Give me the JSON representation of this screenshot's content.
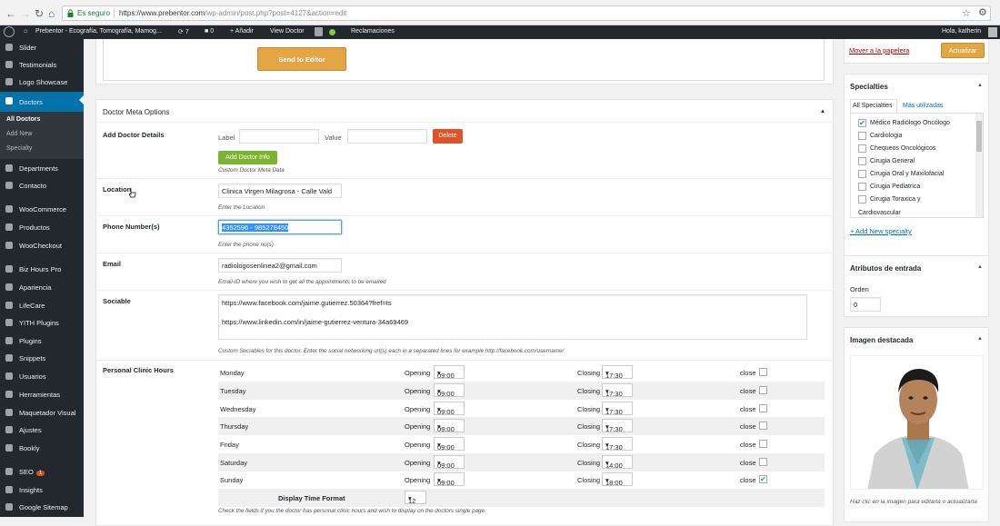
{
  "browser": {
    "secure_label": "Es seguro",
    "url_host": "https://www.prebentor.com",
    "url_path": "/wp-admin/post.php?post=4127&action=edit"
  },
  "adminbar": {
    "site_name": "Prebentor - Ecografía, Tomografía, Mamog...",
    "updates_count": "7",
    "comments_count": "0",
    "add_new": "Añadir",
    "view_doctor": "View Doctor",
    "claims": "Reclamaciones",
    "greeting": "Hola, katherin"
  },
  "sidebar": {
    "items": [
      {
        "label": "Slider"
      },
      {
        "label": "Testimonials"
      },
      {
        "label": "Logo Showcase"
      },
      {
        "label": "Doctors"
      },
      {
        "label": "Departments"
      },
      {
        "label": "Contacto"
      },
      {
        "label": "WooCommerce"
      },
      {
        "label": "Productos"
      },
      {
        "label": "WooCheckout"
      },
      {
        "label": "Biz Hours Pro"
      },
      {
        "label": "Apariencia"
      },
      {
        "label": "LifeCare"
      },
      {
        "label": "YITH Plugins"
      },
      {
        "label": "Plugins"
      },
      {
        "label": "Snippets"
      },
      {
        "label": "Usuarios"
      },
      {
        "label": "Herramientas"
      },
      {
        "label": "Maquetador Visual"
      },
      {
        "label": "Ajustes"
      },
      {
        "label": "Bookly"
      },
      {
        "label": "SEO"
      },
      {
        "label": "Insights"
      },
      {
        "label": "Google Sitemap"
      }
    ],
    "submenu": [
      "All Doctors",
      "Add New",
      "Specialty"
    ],
    "seo_badge": "1"
  },
  "editor": {
    "send_button": "Send to Editor"
  },
  "meta": {
    "title": "Doctor Meta Options",
    "add_details_label": "Add Doctor Details",
    "label_text": "Label",
    "value_text": "Value",
    "delete_button": "Delete",
    "add_info_button": "Add Doctor Info",
    "custom_hint": "Custom Doctor Meta Data",
    "location_label": "Location",
    "location_value": "Clinica Virgen Milagrosa - Calle Vald",
    "location_hint": "Enter the Location",
    "phone_label": "Phone Number(s)",
    "phone_value": "4352596 - 985278450",
    "phone_hint": "Enter the phone no(s)",
    "email_label": "Email",
    "email_value": "radiologosenlinea2@gmail.com",
    "email_hint": "Email-ID where you wish to get all the appointments to be emailed",
    "sociable_label": "Sociable",
    "sociable_line1": "https://www.facebook.com/jaime.gutierrez.50364?fref=ts",
    "sociable_line2": "https://www.linkedin.com/in/jaime-gutierrez-ventura-34a69469",
    "sociable_hint": "Custom Sociables for this doctor. Enter the social networking url(s) each in a separated lines for example http://facebook.com/username/",
    "hours_label": "Personal Clinic Hours",
    "opening_text": "Opening",
    "closing_text": "Closing",
    "close_text": "close",
    "hours": [
      {
        "day": "Monday",
        "open": "09:00",
        "close": "17:30",
        "closed": false
      },
      {
        "day": "Tuesday",
        "open": "09:00",
        "close": "17:30",
        "closed": false
      },
      {
        "day": "Wednesday",
        "open": "09:00",
        "close": "17:30",
        "closed": false
      },
      {
        "day": "Thursday",
        "open": "09:00",
        "close": "17:30",
        "closed": false
      },
      {
        "day": "Friday",
        "open": "09:00",
        "close": "17:30",
        "closed": false
      },
      {
        "day": "Saturday",
        "open": "09:00",
        "close": "14:00",
        "closed": false
      },
      {
        "day": "Sunday",
        "open": "09:00",
        "close": "18:00",
        "closed": true
      }
    ],
    "time_format_label": "Display Time Format",
    "time_format_value": "12",
    "hours_hint": "Check the fields if you the doctor has personal clinic hours and wish to display on the doctors single page."
  },
  "publish": {
    "trash_link": "Mover a la papelera",
    "update_button": "Actualizar"
  },
  "specialties": {
    "title": "Specialties",
    "tab_all": "All Specialties",
    "tab_used": "Más utilizadas",
    "items": [
      {
        "label": "Médico Radiólogo Oncólogo",
        "checked": true
      },
      {
        "label": "Cardiologia",
        "checked": false
      },
      {
        "label": "Chequeos Oncológicos",
        "checked": false
      },
      {
        "label": "Cirugia General",
        "checked": false
      },
      {
        "label": "Cirugia Oral y Maxilofacial",
        "checked": false
      },
      {
        "label": "Cirugia Pediatrica",
        "checked": false
      },
      {
        "label": "Cirugia Toraxica y",
        "checked": false
      }
    ],
    "overflow_text": "Cardiovascular",
    "add_new": "+ Add New specialty"
  },
  "attributes": {
    "title": "Atributos de entrada",
    "order_label": "Orden",
    "order_value": "0"
  },
  "featured": {
    "title": "Imagen destacada",
    "hint": "Haz clic en la imagen para editarla o actualizarla"
  }
}
